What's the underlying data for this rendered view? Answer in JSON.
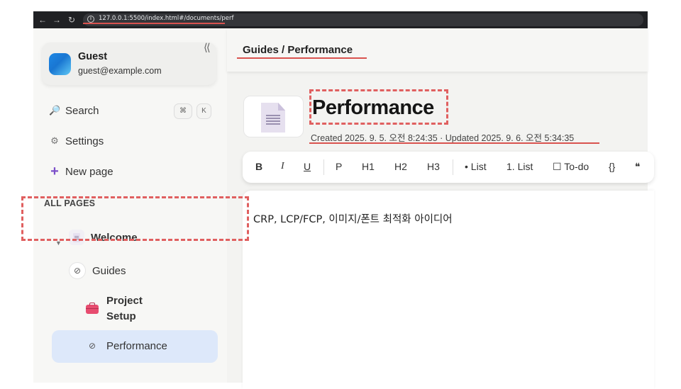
{
  "browser": {
    "url": "127.0.0.1:5500/index.html#/documents/perf",
    "back_icon": "arrow-left-icon",
    "forward_icon": "arrow-right-icon",
    "reload_icon": "reload-icon"
  },
  "sidebar": {
    "collapse_glyph": "⟨⟨",
    "user": {
      "name": "Guest",
      "email": "guest@example.com"
    },
    "menu": [
      {
        "label": "Search",
        "icon": "search-icon",
        "shortcut": [
          "⌘",
          "K"
        ]
      },
      {
        "label": "Settings",
        "icon": "gear-icon"
      },
      {
        "label": "New page",
        "icon": "plus-icon"
      }
    ],
    "section_label": "ALL PAGES",
    "pages": [
      {
        "label": "Welcome",
        "icon": "document-icon"
      },
      {
        "label": "Guides",
        "icon": "no-icon",
        "expanded": true
      },
      {
        "label": "Project",
        "label2": "Setup",
        "icon": "toolbox-icon"
      },
      {
        "label": "Performance",
        "icon": "no-icon",
        "selected": true
      }
    ]
  },
  "header": {
    "breadcrumb": "Guides / Performance"
  },
  "page": {
    "title": "Performance",
    "meta": "Created 2025. 9. 5. 오전 8:24:35 · Updated 2025. 9. 6. 오전 5:34:35"
  },
  "toolbar": {
    "buttons": [
      "B",
      "I",
      "U",
      "P",
      "H1",
      "H2",
      "H3",
      "• List",
      "1. List",
      "☐ To-do",
      "{}",
      "❝"
    ]
  },
  "editor": {
    "content": "CRP, LCP/FCP, 이미지/폰트 최적화 아이디어"
  },
  "colors": {
    "accent_selected": "#dde8fa",
    "annotation": "#e06060"
  }
}
